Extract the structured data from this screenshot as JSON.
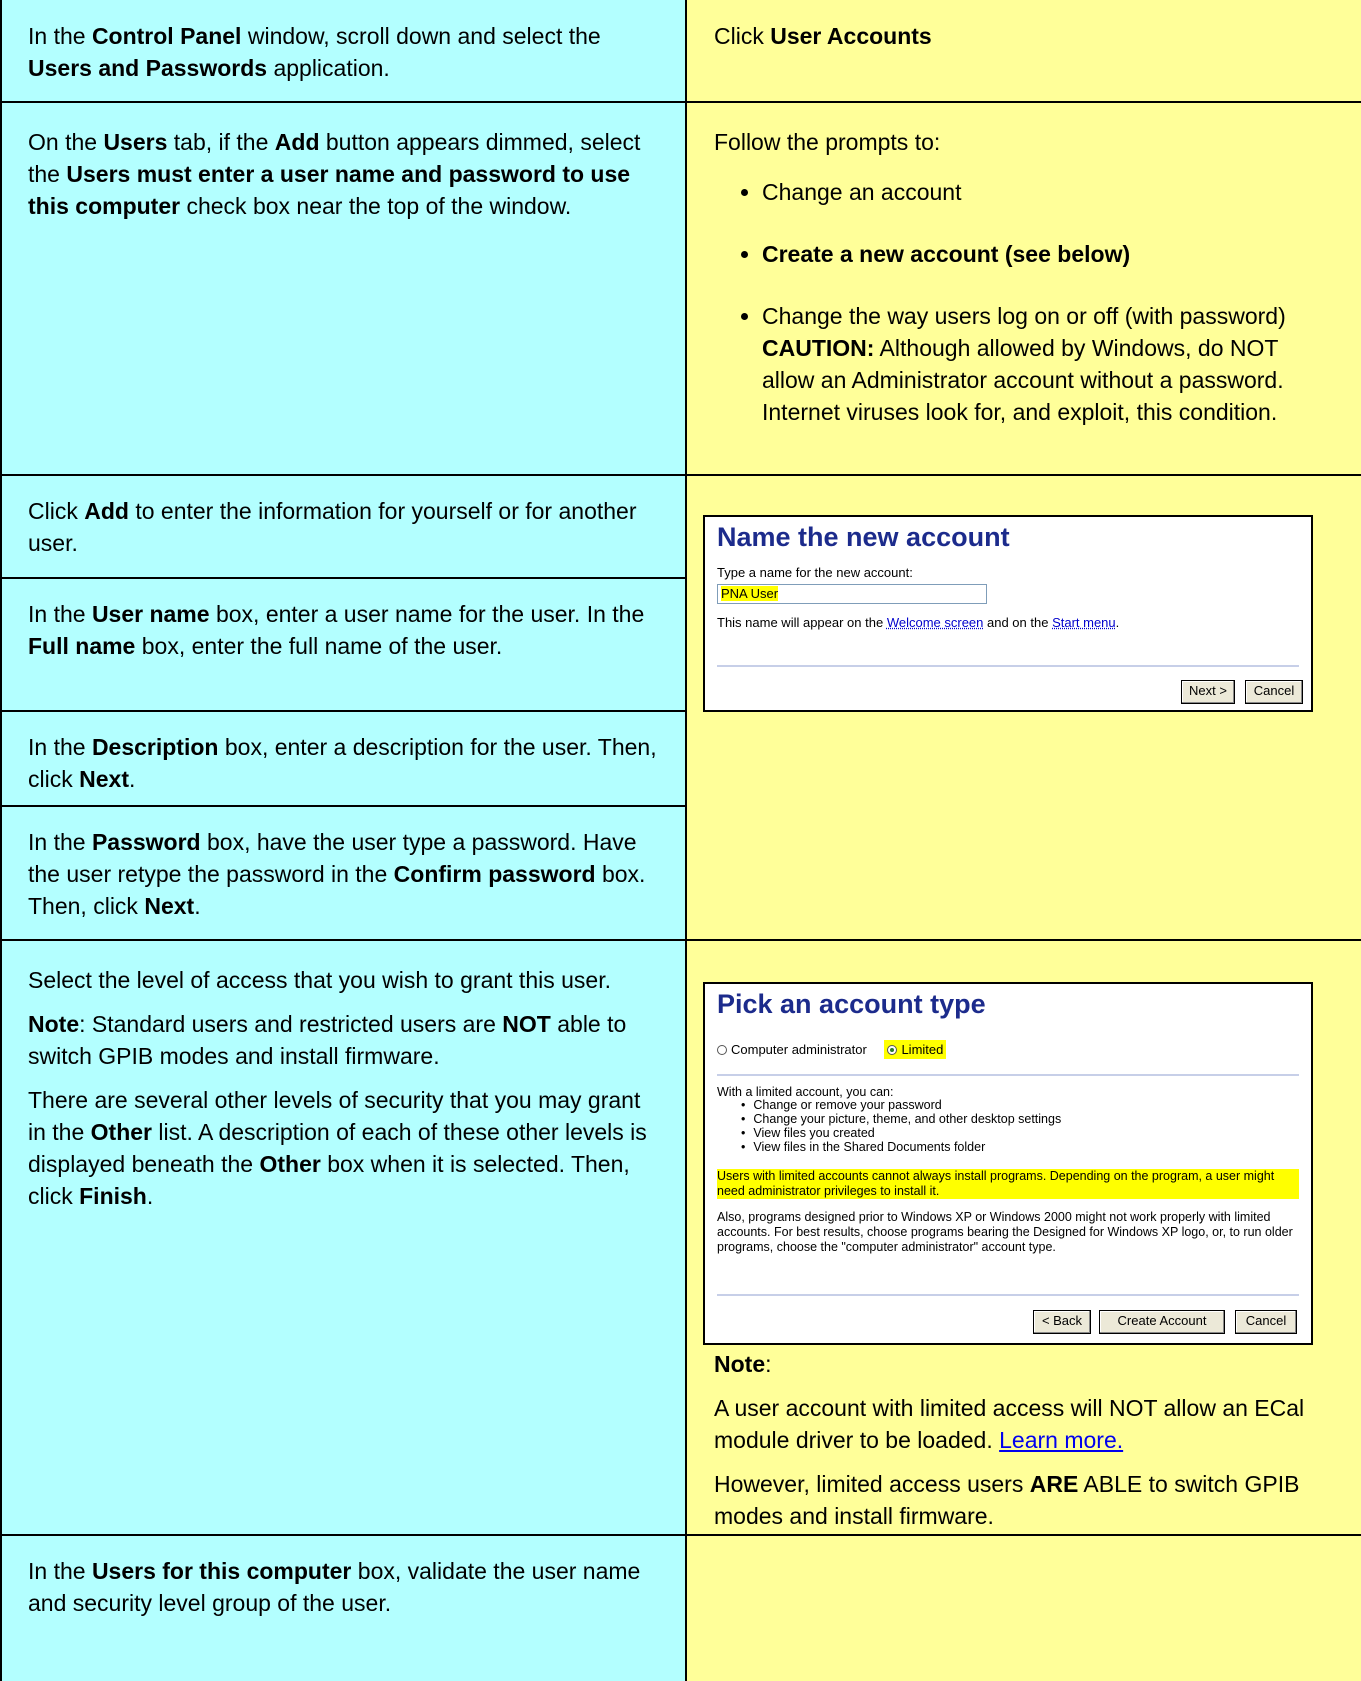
{
  "rows": {
    "r1": {
      "left": {
        "pre": "In the ",
        "b1": "Control Panel",
        "mid": " window, scroll down and select the ",
        "b2": "Users and Passwords",
        "post": " application."
      },
      "right": {
        "pre": "Click ",
        "b1": "User Accounts"
      }
    },
    "r2": {
      "left": {
        "pre": "On the ",
        "b1": "Users",
        "mid1": " tab, if the ",
        "b2": "Add",
        "mid2": " button appears dimmed, select the ",
        "b3": "Users must enter a user name and password to use this computer",
        "post": " check box near the top of the window."
      },
      "right": {
        "intro": "Follow the prompts to:",
        "item1": "Change an account",
        "item2": "Create a new account (see below)",
        "item3_pre": "Change the way users log on or off (with password) ",
        "item3_bold": "CAUTION:",
        "item3_post": " Although allowed by Windows, do NOT allow an Administrator account without a password. Internet viruses look for, and exploit, this condition."
      }
    },
    "r3": {
      "left": {
        "pre": "Click ",
        "b1": "Add",
        "post": " to enter the information for yourself or for another user."
      }
    },
    "r4": {
      "left": {
        "pre": "In the ",
        "b1": "User name",
        "mid": " box, enter a user name for the user. In the ",
        "b2": "Full name",
        "post": " box, enter the full name of the user."
      }
    },
    "r5": {
      "left": {
        "pre": "In the ",
        "b1": "Description",
        "mid": " box, enter a description for the user. Then, click ",
        "b2": "Next",
        "post": "."
      }
    },
    "r6": {
      "left": {
        "pre": "In the ",
        "b1": "Password",
        "mid1": " box, have the user type a password. Have the user retype the password in the ",
        "b2": "Confirm password",
        "mid2": " box. Then, click ",
        "b3": "Next",
        "post": "."
      }
    },
    "r7": {
      "left": {
        "p1": "Select the level of access that you wish to grant this user.",
        "p2_b1": "Note",
        "p2_mid": ": Standard users and restricted users are ",
        "p2_b2": "NOT",
        "p2_post": " able to switch GPIB modes and install firmware.",
        "p3_pre": "There are several other levels of security that you may grant in the ",
        "p3_b1": "Other",
        "p3_mid": " list. A description of each of these other levels is displayed beneath the ",
        "p3_b2": "Other",
        "p3_mid2": " box when it is selected. Then, click ",
        "p3_b3": "Finish",
        "p3_post": "."
      },
      "right": {
        "note_label": "Note",
        "note_colon": ":",
        "p1_pre": "A user account with limited access will NOT allow an ECal module driver to be loaded. ",
        "p1_link": "Learn more.",
        "p2_pre": "However, limited access users ",
        "p2_b": "ARE",
        "p2_post": " ABLE to switch GPIB modes and install firmware."
      }
    },
    "r8": {
      "left": {
        "pre": "In the ",
        "b1": "Users for this computer",
        "post": " box, validate the user name and security level group of the user."
      }
    }
  },
  "dialog1": {
    "title": "Name the new account",
    "prompt": "Type a name for the new account:",
    "input_value": "PNA User",
    "info_pre": "This name will appear on the ",
    "info_link1": "Welcome screen",
    "info_mid": " and on the ",
    "info_link2": "Start menu",
    "info_post": ".",
    "next_label": "Next >",
    "cancel_label": "Cancel"
  },
  "dialog2": {
    "title": "Pick an account type",
    "opt1": "Computer administrator",
    "opt2": "Limited",
    "list_intro": "With a limited account, you can:",
    "items": [
      "Change or remove your password",
      "Change your picture, theme, and other desktop settings",
      "View files you created",
      "View files in the Shared Documents folder"
    ],
    "warning": "Users with limited accounts cannot always install programs. Depending on the program, a user might need administrator privileges to install it.",
    "also": "Also, programs designed prior to Windows XP or Windows 2000 might not work properly with limited accounts. For best results, choose programs bearing the Designed for Windows XP logo, or, to run older programs, choose the \"computer administrator\" account type.",
    "back_label": "< Back",
    "create_label": "Create Account",
    "cancel_label": "Cancel"
  }
}
